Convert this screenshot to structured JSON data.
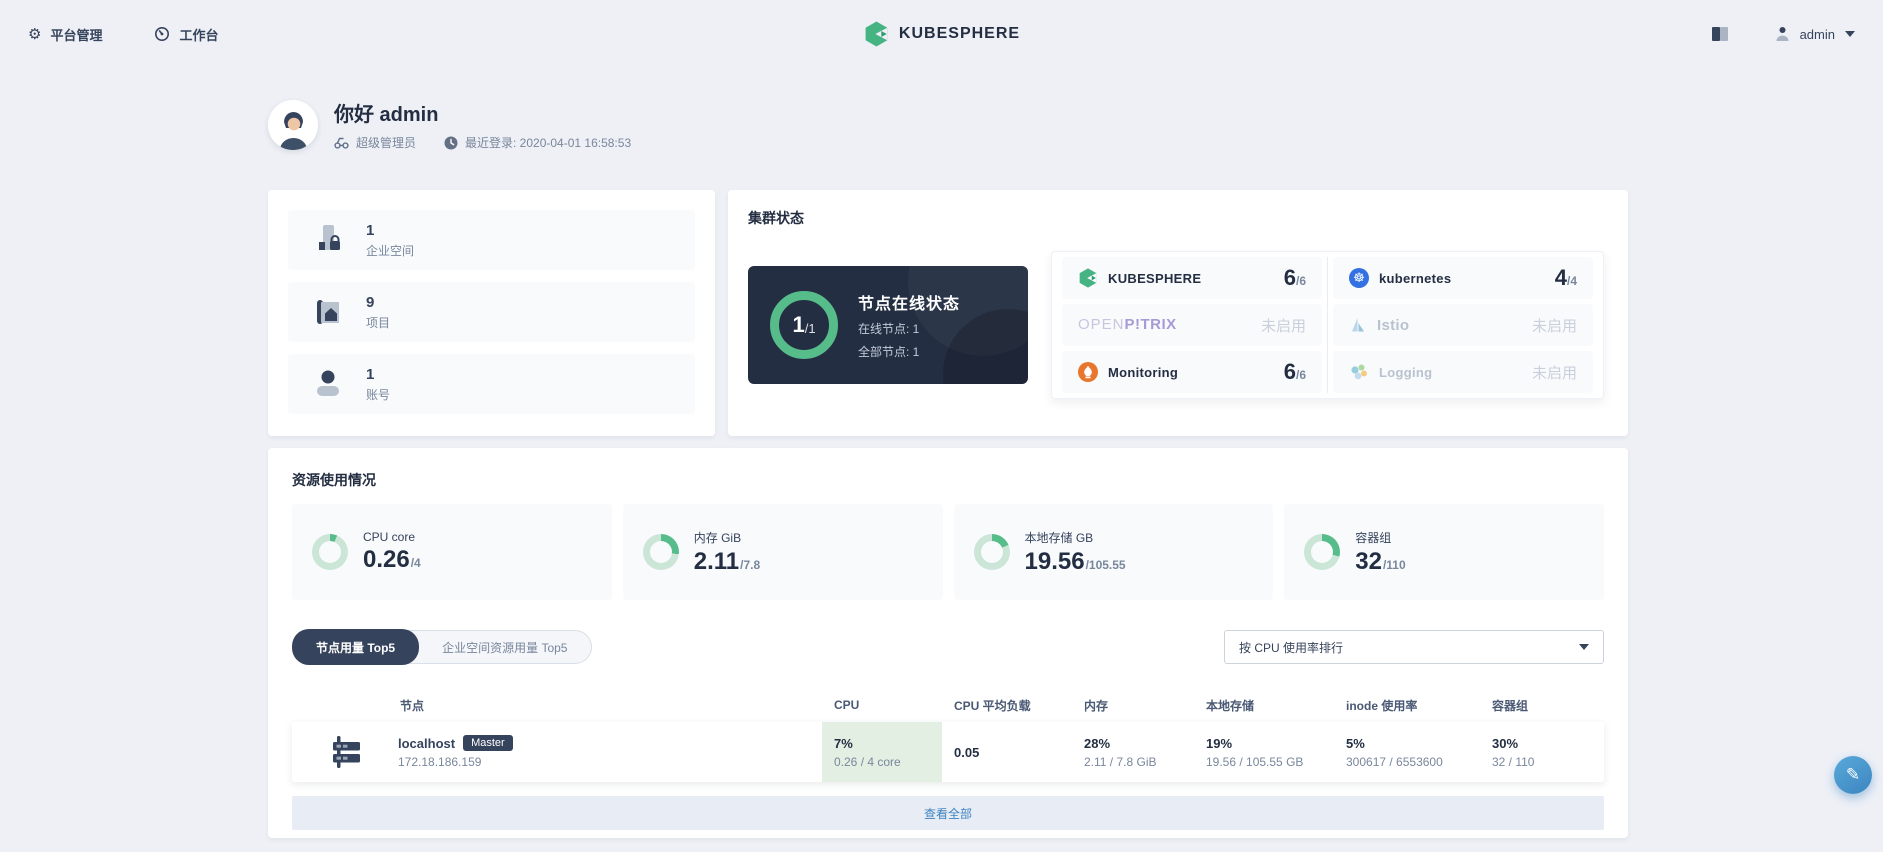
{
  "navbar": {
    "platform_label": "平台管理",
    "workbench_label": "工作台",
    "logo_text": "KUBESPHERE",
    "username": "admin"
  },
  "greeting": {
    "title": "你好 admin",
    "role": "超级管理员",
    "last_login": "最近登录: 2020-04-01 16:58:53"
  },
  "overview": {
    "items": [
      {
        "value": "1",
        "label": "企业空间"
      },
      {
        "value": "9",
        "label": "项目"
      },
      {
        "value": "1",
        "label": "账号"
      }
    ]
  },
  "cluster": {
    "title": "集群状态",
    "node_panel": {
      "current": "1",
      "suffix": "/1",
      "title": "节点在线状态",
      "online": "在线节点: 1",
      "all": "全部节点: 1"
    },
    "components": [
      {
        "name": "KUBESPHERE",
        "value": "6",
        "suffix": "/6"
      },
      {
        "name": "kubernetes",
        "value": "4",
        "suffix": "/4",
        "icon_glyph": "☸"
      },
      {
        "word1": "OPEN",
        "word2": "P!TRIX",
        "status": "未启用"
      },
      {
        "name": "Istio",
        "status": "未启用"
      },
      {
        "name": "Monitoring",
        "value": "6",
        "suffix": "/6"
      },
      {
        "name": "Logging",
        "status": "未启用"
      }
    ]
  },
  "resources": {
    "title": "资源使用情况",
    "stats": [
      {
        "label": "CPU core",
        "value": "0.26",
        "suffix": "/4",
        "pct": 6.5
      },
      {
        "label": "内存 GiB",
        "value": "2.11",
        "suffix": "/7.8",
        "pct": 27
      },
      {
        "label": "本地存储 GB",
        "value": "19.56",
        "suffix": "/105.55",
        "pct": 18.5
      },
      {
        "label": "容器组",
        "value": "32",
        "suffix": "/110",
        "pct": 29
      }
    ],
    "tabs": {
      "active": "节点用量 Top5",
      "inactive": "企业空间资源用量 Top5"
    },
    "sort_label": "按 CPU 使用率排行",
    "table": {
      "headers": {
        "node": "节点",
        "cpu": "CPU",
        "load": "CPU 平均负载",
        "memory": "内存",
        "storage": "本地存储",
        "inode": "inode 使用率",
        "pods": "容器组"
      },
      "row": {
        "name": "localhost",
        "badge": "Master",
        "ip": "172.18.186.159",
        "cpu_pct": "7%",
        "cpu_detail": "0.26 / 4 core",
        "load": "0.05",
        "mem_pct": "28%",
        "mem_detail": "2.11 / 7.8 GiB",
        "storage_pct": "19%",
        "storage_detail": "19.56 / 105.55 GB",
        "inode_pct": "5%",
        "inode_detail": "300617 / 6553600",
        "pods_pct": "30%",
        "pods_detail": "32 / 110"
      }
    },
    "view_all": "查看全部"
  },
  "colors": {
    "green": "#55bc8a",
    "track": "#cbe5d7",
    "dark": "#242e42"
  }
}
